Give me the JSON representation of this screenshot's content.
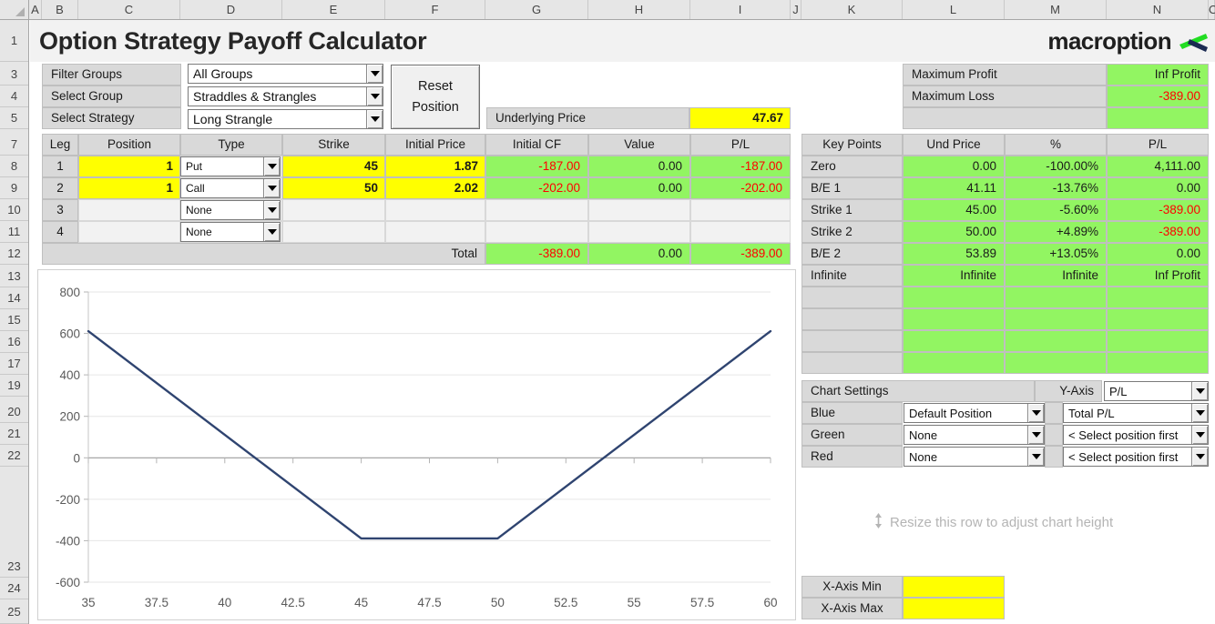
{
  "app": {
    "title": "Option Strategy Payoff Calculator",
    "logo_word": "macroption"
  },
  "columns": [
    "A",
    "B",
    "C",
    "D",
    "E",
    "F",
    "G",
    "H",
    "I",
    "J",
    "K",
    "L",
    "M",
    "N",
    "O"
  ],
  "rows": [
    "1",
    "3",
    "4",
    "5",
    "7",
    "8",
    "9",
    "10",
    "11",
    "12",
    "13",
    "14",
    "15",
    "16",
    "17",
    "19",
    "20",
    "21",
    "22",
    "23",
    "24",
    "25"
  ],
  "controls": {
    "filter_groups_label": "Filter Groups",
    "filter_groups_value": "All Groups",
    "select_group_label": "Select Group",
    "select_group_value": "Straddles & Strangles",
    "select_strategy_label": "Select Strategy",
    "select_strategy_value": "Long Strangle",
    "reset_button": "Reset\nPosition",
    "reset_button_line1": "Reset",
    "reset_button_line2": "Position",
    "underlying_price_label": "Underlying Price",
    "underlying_price_value": "47.67"
  },
  "summary": {
    "max_profit_label": "Maximum Profit",
    "max_profit_value": "Inf Profit",
    "max_loss_label": "Maximum Loss",
    "max_loss_value": "-389.00",
    "blank_label": "",
    "blank_value": ""
  },
  "legs_table": {
    "headers": [
      "Leg",
      "Position",
      "Type",
      "Strike",
      "Initial Price",
      "Initial CF",
      "Value",
      "P/L"
    ],
    "rows": [
      {
        "leg": "1",
        "position": "1",
        "type": "Put",
        "strike": "45",
        "initial_price": "1.87",
        "initial_cf": "-187.00",
        "value": "0.00",
        "pl": "-187.00"
      },
      {
        "leg": "2",
        "position": "1",
        "type": "Call",
        "strike": "50",
        "initial_price": "2.02",
        "initial_cf": "-202.00",
        "value": "0.00",
        "pl": "-202.00"
      },
      {
        "leg": "3",
        "position": "",
        "type": "None",
        "strike": "",
        "initial_price": "",
        "initial_cf": "",
        "value": "",
        "pl": ""
      },
      {
        "leg": "4",
        "position": "",
        "type": "None",
        "strike": "",
        "initial_price": "",
        "initial_cf": "",
        "value": "",
        "pl": ""
      }
    ],
    "total_label": "Total",
    "total_initial_cf": "-389.00",
    "total_value": "0.00",
    "total_pl": "-389.00",
    "type_options": [
      "None",
      "Call",
      "Put"
    ]
  },
  "key_points": {
    "headers": [
      "Key Points",
      "Und Price",
      "%",
      "P/L"
    ],
    "rows": [
      {
        "name": "Zero",
        "und_price": "0.00",
        "pct": "-100.00%",
        "pl": "4,111.00",
        "pl_negative": false
      },
      {
        "name": "B/E 1",
        "und_price": "41.11",
        "pct": "-13.76%",
        "pl": "0.00",
        "pl_negative": false
      },
      {
        "name": "Strike 1",
        "und_price": "45.00",
        "pct": "-5.60%",
        "pl": "-389.00",
        "pl_negative": true
      },
      {
        "name": "Strike 2",
        "und_price": "50.00",
        "pct": "+4.89%",
        "pl": "-389.00",
        "pl_negative": true
      },
      {
        "name": "B/E 2",
        "und_price": "53.89",
        "pct": "+13.05%",
        "pl": "0.00",
        "pl_negative": false
      },
      {
        "name": "Infinite",
        "und_price": "Infinite",
        "pct": "Infinite",
        "pl": "Inf Profit",
        "pl_negative": false
      },
      {
        "name": "",
        "und_price": "",
        "pct": "",
        "pl": "",
        "pl_negative": false
      },
      {
        "name": "",
        "und_price": "",
        "pct": "",
        "pl": "",
        "pl_negative": false
      },
      {
        "name": "",
        "und_price": "",
        "pct": "",
        "pl": "",
        "pl_negative": false
      },
      {
        "name": "",
        "und_price": "",
        "pct": "",
        "pl": "",
        "pl_negative": false
      }
    ]
  },
  "chart_settings": {
    "title": "Chart Settings",
    "yaxis_label": "Y-Axis",
    "yaxis_value": "P/L",
    "rows": [
      {
        "color_label": "Blue",
        "position": "Default Position",
        "series": "Total P/L"
      },
      {
        "color_label": "Green",
        "position": "None",
        "series": "< Select position first"
      },
      {
        "color_label": "Red",
        "position": "None",
        "series": "< Select position first"
      }
    ],
    "resize_hint": "Resize this row to adjust chart height",
    "xaxis_min_label": "X-Axis Min",
    "xaxis_min_value": "",
    "xaxis_max_label": "X-Axis Max",
    "xaxis_max_value": ""
  },
  "chart_data": {
    "type": "line",
    "title": "",
    "xlabel": "",
    "ylabel": "",
    "xlim": [
      35,
      60
    ],
    "ylim": [
      -600,
      800
    ],
    "xticks": [
      "35",
      "37.5",
      "40",
      "42.5",
      "45",
      "47.5",
      "50",
      "52.5",
      "55",
      "57.5",
      "60"
    ],
    "xtick_values": [
      35,
      37.5,
      40,
      42.5,
      45,
      47.5,
      50,
      52.5,
      55,
      57.5,
      60
    ],
    "yticks": [
      "800",
      "600",
      "400",
      "200",
      "0",
      "-200",
      "-400",
      "-600"
    ],
    "ytick_values": [
      800,
      600,
      400,
      200,
      0,
      -200,
      -400,
      -600
    ],
    "grid": true,
    "legend": false,
    "series": [
      {
        "name": "Total P/L",
        "color": "#2f4470",
        "x": [
          35,
          41.11,
          45,
          50,
          53.89,
          60
        ],
        "y": [
          611,
          0,
          -389,
          -389,
          0,
          611
        ]
      }
    ]
  },
  "colors": {
    "green_fill": "#92f562",
    "yellow_fill": "#ffff00",
    "label_fill": "#d9d9d9",
    "negative_text": "#ff0000",
    "chart_line": "#2f4470",
    "logo_green": "#22dd22",
    "logo_navy": "#1b2a52"
  }
}
